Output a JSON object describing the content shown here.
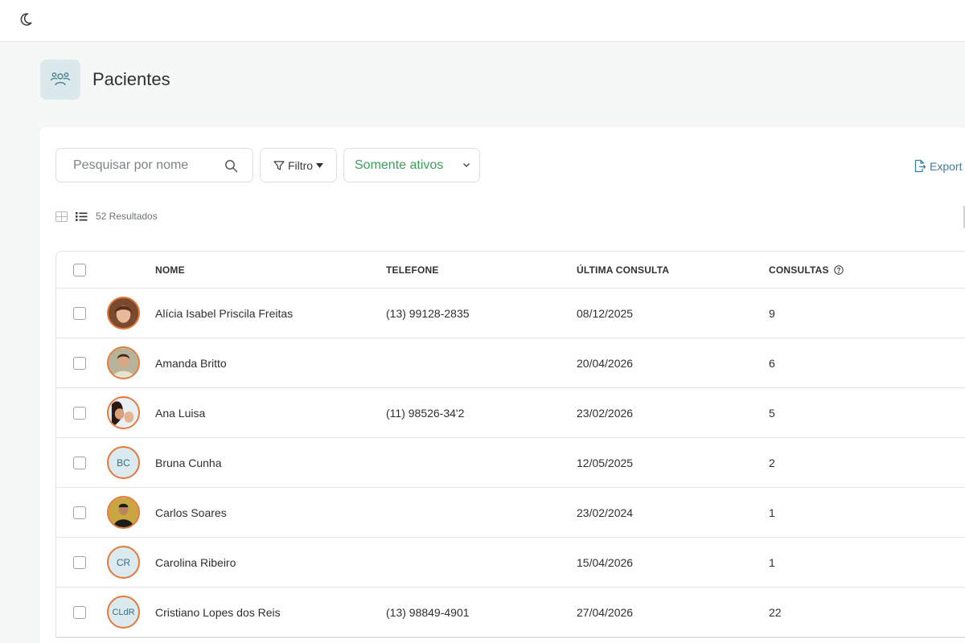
{
  "page": {
    "title": "Pacientes"
  },
  "toolbar": {
    "search_placeholder": "Pesquisar por nome",
    "filter_label": "Filtro",
    "status_select": "Somente ativos",
    "export_label": "Export"
  },
  "results": {
    "count_label": "52 Resultados"
  },
  "table": {
    "headers": {
      "name": "NOME",
      "phone": "TELEFONE",
      "last": "ÚLTIMA CONSULTA",
      "consults": "CONSULTAS"
    },
    "rows": [
      {
        "name": "Alícia Isabel Priscila Freitas",
        "phone": "(13) 99128-2835",
        "last": "08/12/2025",
        "consults": "9",
        "avatar": "photo"
      },
      {
        "name": "Amanda Britto",
        "phone": "",
        "last": "20/04/2026",
        "consults": "6",
        "avatar": "photo"
      },
      {
        "name": "Ana Luisa",
        "phone": "(11) 98526-34'2",
        "last": "23/02/2026",
        "consults": "5",
        "avatar": "photo"
      },
      {
        "name": "Bruna Cunha",
        "phone": "",
        "last": "12/05/2025",
        "consults": "2",
        "avatar": "BC"
      },
      {
        "name": "Carlos Soares",
        "phone": "",
        "last": "23/02/2024",
        "consults": "1",
        "avatar": "photo"
      },
      {
        "name": "Carolina Ribeiro",
        "phone": "",
        "last": "15/04/2026",
        "consults": "1",
        "avatar": "CR"
      },
      {
        "name": "Cristiano Lopes dos Reis",
        "phone": "(13) 98849-4901",
        "last": "27/04/2026",
        "consults": "22",
        "avatar": "CLdR"
      }
    ]
  },
  "colors": {
    "accent_green": "#3aa05a",
    "link_blue": "#3b7ea1",
    "avatar_border": "#e27a3f",
    "icon_tile": "#dbe9ec"
  }
}
